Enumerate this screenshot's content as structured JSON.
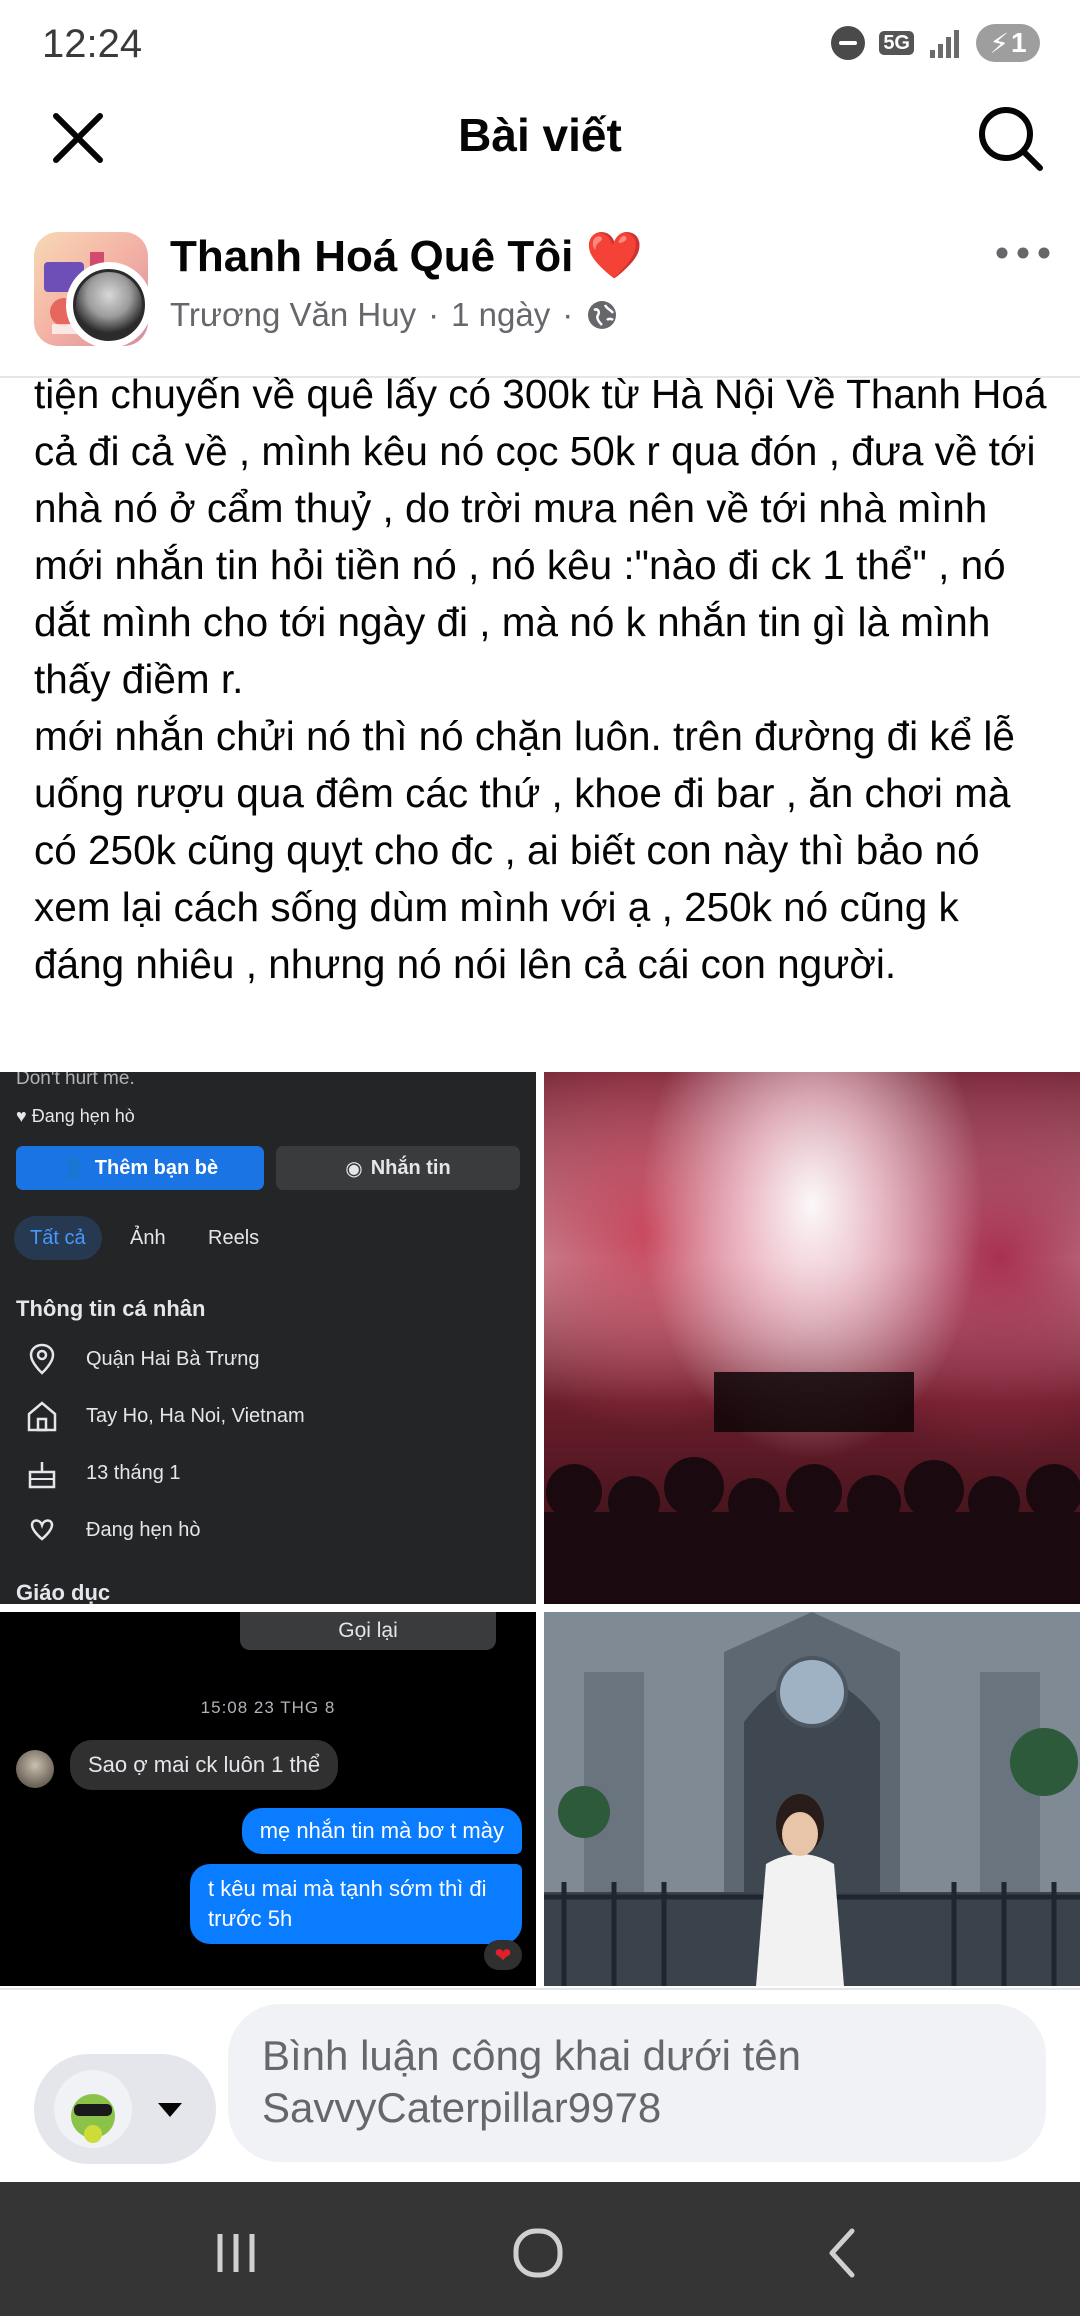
{
  "status_bar": {
    "time": "12:24",
    "network": "5G",
    "battery": "1"
  },
  "header": {
    "title": "Bài viết"
  },
  "post": {
    "group_name": "Thanh Hoá Quê Tôi",
    "heart_emoji": "❤️",
    "author": "Trương Văn Huy",
    "time": "1 ngày",
    "separator": "·",
    "body": "tiện chuyến về quê lấy có 300k từ Hà Nội Về Thanh Hoá cả đi cả về , mình kêu nó cọc 50k r qua đón , đưa về tới nhà nó ở cẩm thuỷ , do trời mưa nên về tới nhà mình mới nhắn tin hỏi tiền nó , nó kêu :\"nào đi ck 1 thể\" , nó dắt mình cho tới ngày đi , mà nó k nhắn tin gì là mình thấy điềm r.\nmới nhắn chửi nó thì nó chặn luôn. trên đường đi kể lễ uống rượu qua đêm các thứ , khoe đi bar , ăn chơi mà có 250k cũng quỵt cho đc , ai biết con này thì bảo nó xem lại cách sống dùm mình với ạ , 250k nó cũng k đáng nhiêu , nhưng nó nói lên cả cái con người."
  },
  "profile_screenshot": {
    "top_text": "Don't hurt me.",
    "relationship_line": "Đang hẹn hò",
    "add_friend": "Thêm bạn bè",
    "message": "Nhắn tin",
    "tabs": [
      "Tất cả",
      "Ảnh",
      "Reels"
    ],
    "section_title": "Thông tin cá nhân",
    "info": [
      {
        "icon": "location-pin-icon",
        "text": "Quận Hai Bà Trưng"
      },
      {
        "icon": "home-icon",
        "text": "Tay Ho, Ha Noi, Vietnam"
      },
      {
        "icon": "birthday-cake-icon",
        "text": "13 tháng 1"
      },
      {
        "icon": "hearts-icon",
        "text": "Đang hẹn hò"
      }
    ],
    "education_title": "Giáo dục"
  },
  "chat_screenshot": {
    "call_again": "Gọi lại",
    "timestamp": "15:08 23 THG 8",
    "incoming": "Sao ợ mai ck luôn 1 thể",
    "outgoing_1": "mẹ nhắn tin mà bơ t mày",
    "outgoing_2": "t kêu mai mà tạnh sớm thì đi trước 5h",
    "reaction": "❤"
  },
  "comment_bar": {
    "placeholder": "Bình luận công khai dưới tên SavvyCaterpillar9978"
  },
  "colors": {
    "fb_blue": "#1b74e4",
    "messenger_blue": "#0a7cff",
    "heart_red": "#e0202a",
    "secondary_text": "#65676b"
  }
}
